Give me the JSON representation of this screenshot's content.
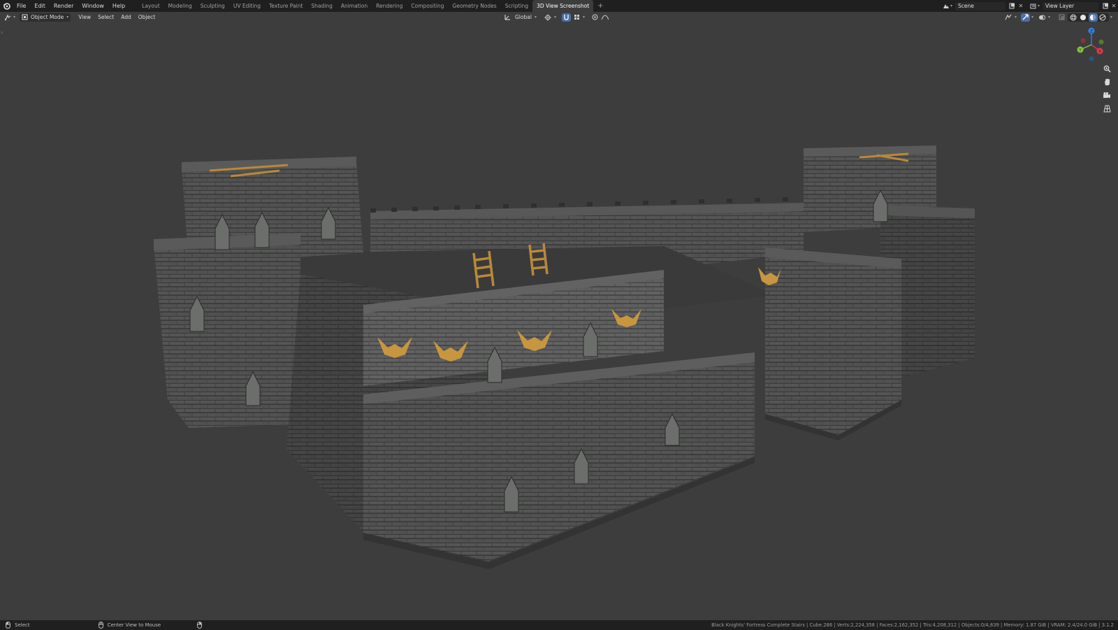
{
  "app": {
    "icons": {
      "logo": "blender-logo-icon",
      "editor": "editor-type-icon"
    }
  },
  "menus": [
    "File",
    "Edit",
    "Render",
    "Window",
    "Help"
  ],
  "workspaces": [
    {
      "label": "Layout",
      "active": false
    },
    {
      "label": "Modeling",
      "active": false
    },
    {
      "label": "Sculpting",
      "active": false
    },
    {
      "label": "UV Editing",
      "active": false
    },
    {
      "label": "Texture Paint",
      "active": false
    },
    {
      "label": "Shading",
      "active": false
    },
    {
      "label": "Animation",
      "active": false
    },
    {
      "label": "Rendering",
      "active": false
    },
    {
      "label": "Compositing",
      "active": false
    },
    {
      "label": "Geometry Nodes",
      "active": false
    },
    {
      "label": "Scripting",
      "active": false
    },
    {
      "label": "3D View Screenshot",
      "active": true
    }
  ],
  "add_workspace": "+",
  "scene": {
    "label": "Scene"
  },
  "view_layer": {
    "label": "View Layer"
  },
  "header": {
    "mode": "Object Mode",
    "menus": [
      "View",
      "Select",
      "Add",
      "Object"
    ],
    "orientation": "Global"
  },
  "status": {
    "left_hint": "Select",
    "middle_hint": "Center View to Mouse",
    "stats": "Black Knights' Fortress Complete Stairs | Cube.286 | Verts:2,224,358 | Faces:2,162,352 | Tris:4,208,312 | Objects:0/4,839 | Memory: 1.87 GiB | VRAM: 2.4/24.0 GiB | 3.1.2"
  },
  "gizmo": {
    "x": "X",
    "y": "Y",
    "z": "Z"
  },
  "colors": {
    "viewport_bg": "#3d3d3d",
    "topbar_bg": "#1f1f1f",
    "active_blue": "#4a6fa5",
    "axis_x": "#e8394e",
    "axis_y": "#8ac43f",
    "axis_z": "#2f84e3",
    "stone": "#4b4b4b",
    "wood": "#b8893a"
  }
}
